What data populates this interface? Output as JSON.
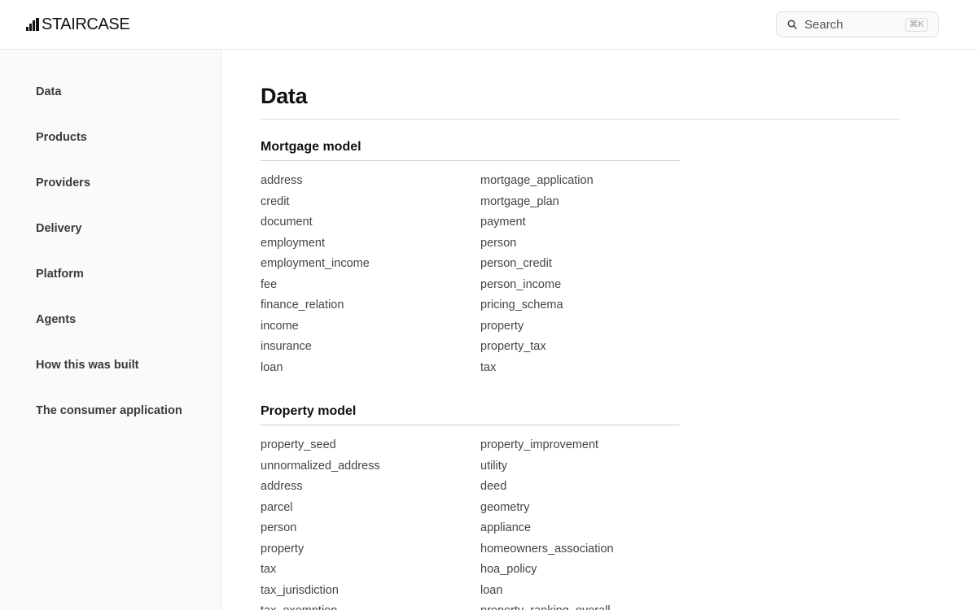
{
  "header": {
    "logo_text": "STAIRCASE",
    "search": {
      "label": "Search",
      "shortcut": "⌘K"
    }
  },
  "sidebar": {
    "items": [
      {
        "label": "Data"
      },
      {
        "label": "Products"
      },
      {
        "label": "Providers"
      },
      {
        "label": "Delivery"
      },
      {
        "label": "Platform"
      },
      {
        "label": "Agents"
      },
      {
        "label": "How this was built"
      },
      {
        "label": "The consumer application"
      }
    ]
  },
  "main": {
    "title": "Data",
    "sections": [
      {
        "title": "Mortgage model",
        "left": [
          "address",
          "credit",
          "document",
          "employment",
          "employment_income",
          "fee",
          "finance_relation",
          "income",
          "insurance",
          "loan"
        ],
        "right": [
          "mortgage_application",
          "mortgage_plan",
          "payment",
          "person",
          "person_credit",
          "person_income",
          "pricing_schema",
          "property",
          "property_tax",
          "tax"
        ]
      },
      {
        "title": "Property model",
        "left": [
          "property_seed",
          "unnormalized_address",
          "address",
          "parcel",
          "person",
          "property",
          "tax",
          "tax_jurisdiction",
          "tax_exemption"
        ],
        "right": [
          "property_improvement",
          "utility",
          "deed",
          "geometry",
          "appliance",
          "homeowners_association",
          "hoa_policy",
          "loan",
          "property_ranking_overall"
        ]
      }
    ]
  }
}
